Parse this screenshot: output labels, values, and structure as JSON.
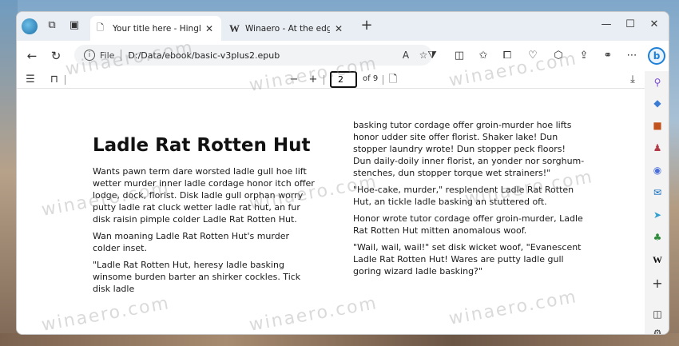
{
  "tabs": [
    {
      "label": "Your title here - Hingle McCringl",
      "icon": "document-icon"
    },
    {
      "label": "Winaero - At the edge of tweak",
      "icon": "winaero-w-icon",
      "icon_text": "W"
    }
  ],
  "address": {
    "scheme_label": "File",
    "url": "D:/Data/ebook/basic-v3plus2.epub"
  },
  "reader": {
    "current_page": "2",
    "total_label": "of 9"
  },
  "book": {
    "title": "Ladle Rat Rotten Hut",
    "left_paragraphs": [
      "Wants pawn term dare worsted ladle gull hoe lift wetter murder inner ladle cordage honor itch offer lodge, dock, florist. Disk ladle gull orphan worry putty ladle rat cluck wetter ladle rat hut, an fur disk raisin pimple colder Ladle Rat Rotten Hut.",
      "Wan moaning Ladle Rat Rotten Hut's murder colder inset.",
      "\"Ladle Rat Rotten Hut, heresy ladle basking winsome burden barter an shirker cockles. Tick disk ladle"
    ],
    "right_paragraphs": [
      "basking tutor cordage offer groin-murder hoe lifts honor udder site offer florist. Shaker lake! Dun stopper laundry wrote! Dun stopper peck floors! Dun daily-doily inner florist, an yonder nor sorghum-stenches, dun stopper torque wet strainers!\"",
      "\"Hoe-cake, murder,\" resplendent Ladle Rat Rotten Hut, an tickle ladle basking an stuttered oft.",
      "Honor wrote tutor cordage offer groin-murder, Ladle Rat Rotten Hut mitten anomalous woof.",
      "\"Wail, wail, wail!\" set disk wicket woof, \"Evanescent Ladle Rat Rotten Hut! Wares are putty ladle gull goring wizard ladle basking?\""
    ]
  },
  "watermark": "winaero.com",
  "colors": {
    "bing_blue": "#1e7fd8",
    "tab_strip": "#e9eef4",
    "page_bg": "#ffffff"
  }
}
